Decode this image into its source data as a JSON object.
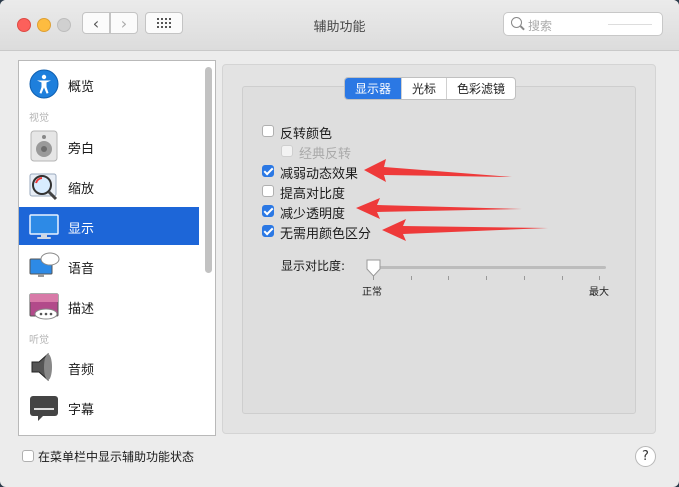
{
  "window": {
    "title": "辅助功能"
  },
  "search": {
    "placeholder": "搜索"
  },
  "sidebar": {
    "items": [
      {
        "label": "概览"
      },
      {
        "label": "旁白"
      },
      {
        "label": "缩放"
      },
      {
        "label": "显示",
        "selected": true
      },
      {
        "label": "语音"
      },
      {
        "label": "描述"
      },
      {
        "label": "音频"
      },
      {
        "label": "字幕"
      }
    ],
    "sections": {
      "vision": "视觉",
      "hearing": "听觉"
    }
  },
  "tabs": [
    {
      "label": "显示器",
      "active": true
    },
    {
      "label": "光标"
    },
    {
      "label": "色彩滤镜"
    }
  ],
  "options": [
    {
      "label": "反转颜色",
      "checked": false
    },
    {
      "label": "经典反转",
      "checked": false,
      "disabled": true
    },
    {
      "label": "减弱动态效果",
      "checked": true
    },
    {
      "label": "提高对比度",
      "checked": false
    },
    {
      "label": "减少透明度",
      "checked": true
    },
    {
      "label": "无需用颜色区分",
      "checked": true
    }
  ],
  "contrast": {
    "label": "显示对比度:",
    "min_label": "正常",
    "max_label": "最大",
    "value": 0
  },
  "footer": {
    "menubar_label": "在菜单栏中显示辅助功能状态",
    "help": "?"
  },
  "colors": {
    "accent": "#2b78e4",
    "selection": "#1d66d8",
    "arrow": "#ee3a3a"
  }
}
